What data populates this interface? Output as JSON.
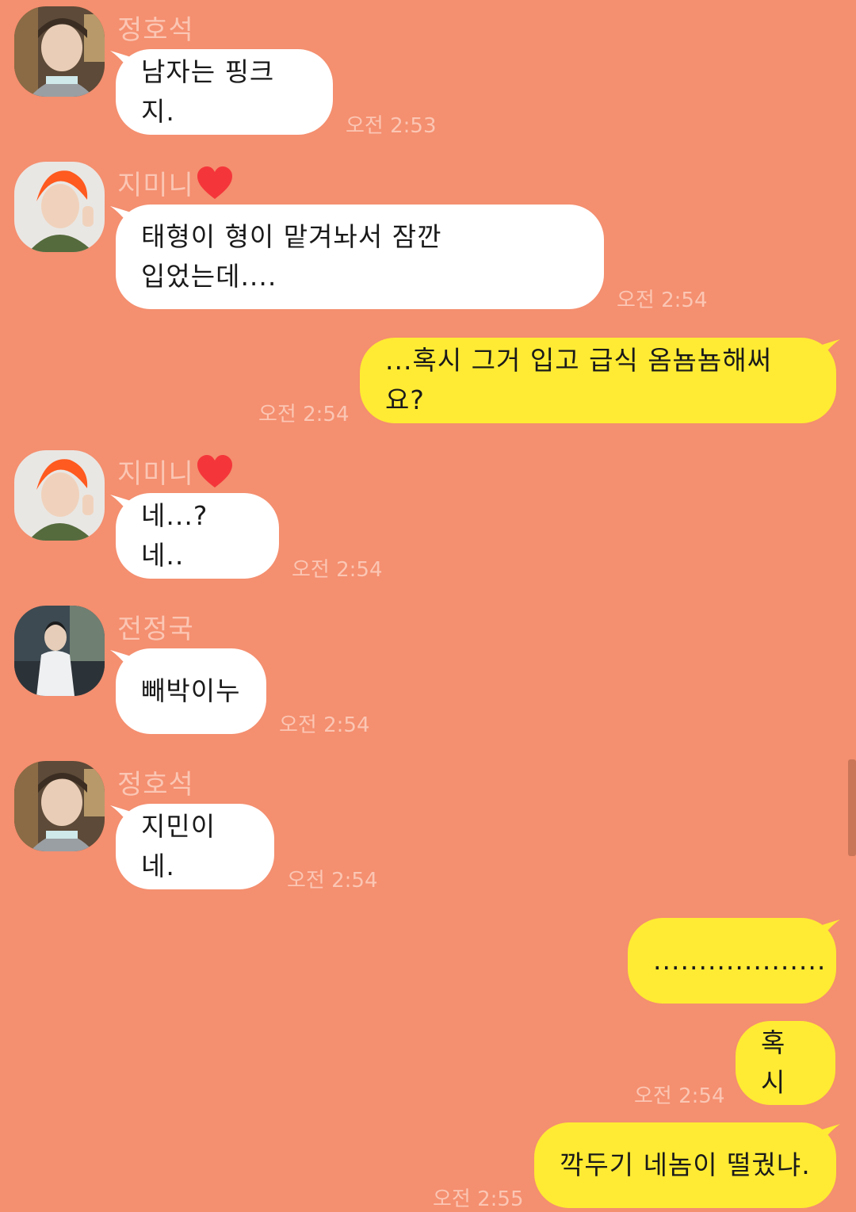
{
  "messages": [
    {
      "sender": "정호석",
      "text": "남자는 핑크지.",
      "time": "오전 2:53"
    },
    {
      "sender": "지미니",
      "text": "태형이 형이 맡겨놔서 잠깐\n입었는데....",
      "time": "오전 2:54"
    },
    {
      "sender": "me",
      "text": "...혹시 그거 입고 급식 옴뇸뇸해써요?",
      "time": "오전 2:54"
    },
    {
      "sender": "지미니",
      "text": "네...? 네..",
      "time": "오전 2:54"
    },
    {
      "sender": "전정국",
      "text": "빼박이누",
      "time": "오전 2:54"
    },
    {
      "sender": "정호석",
      "text": "지민이네.",
      "time": "오전 2:54"
    },
    {
      "sender": "me",
      "text": "...................",
      "time": ""
    },
    {
      "sender": "me",
      "text": "혹시",
      "time": "오전 2:54"
    },
    {
      "sender": "me",
      "text": "깍두기 네놈이 떨궜냐.",
      "time": "오전 2:55"
    }
  ],
  "colors": {
    "background": "#f48f6f",
    "incoming_bubble": "#ffffff",
    "outgoing_bubble": "#ffeb33",
    "meta_text": "#fbc6b4"
  },
  "icons": {
    "heart": "red-heart-emoji"
  }
}
